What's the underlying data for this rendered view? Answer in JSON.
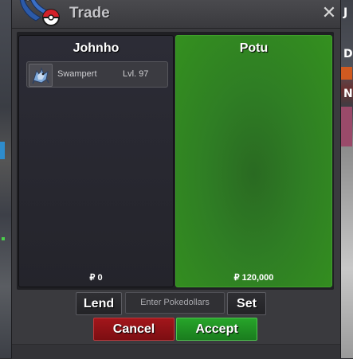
{
  "window": {
    "title": "Trade",
    "close_symbol": "✕"
  },
  "trade": {
    "left": {
      "name": "Johnho",
      "money": "₽ 0",
      "items": [
        {
          "name": "Swampert",
          "level": "Lvl. 97",
          "icon": "swampert-sprite-icon"
        }
      ]
    },
    "right": {
      "name": "Potu",
      "money": "₽ 120,000",
      "items": []
    }
  },
  "controls": {
    "lend_label": "Lend",
    "pokedollars_placeholder": "Enter Pokedollars",
    "set_label": "Set",
    "cancel_label": "Cancel",
    "accept_label": "Accept"
  },
  "background": {
    "right_edge_letters": [
      "J",
      "D",
      "N"
    ]
  },
  "colors": {
    "accept": "#27a52a",
    "cancel": "#a3161b",
    "partner_panel": "#2f7e24"
  }
}
